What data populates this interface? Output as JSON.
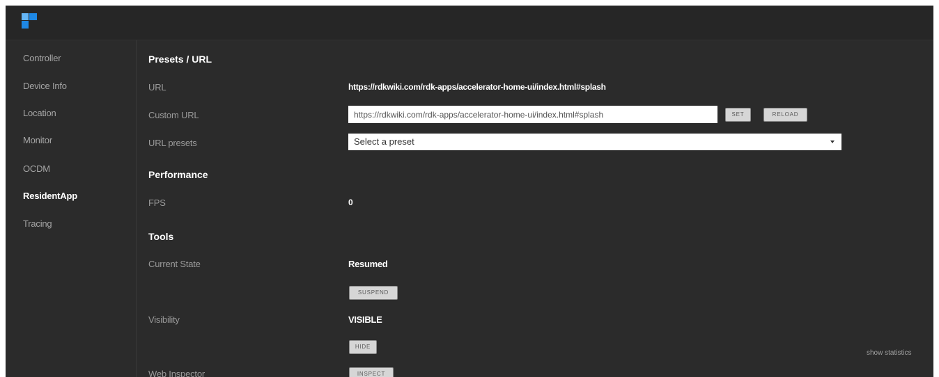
{
  "colors": {
    "background": "#2b2b2b",
    "topbar": "#262626",
    "logo_blue": "#1e88e5",
    "logo_light": "#64b5f6",
    "text_primary": "#ffffff",
    "text_muted": "#9a9a9a",
    "button_bg": "#d6d6d6"
  },
  "logo": {
    "icon": "logo-icon"
  },
  "sidebar": {
    "items": [
      {
        "label": "Controller",
        "active": false
      },
      {
        "label": "Device Info",
        "active": false
      },
      {
        "label": "Location",
        "active": false
      },
      {
        "label": "Monitor",
        "active": false
      },
      {
        "label": "OCDM",
        "active": false
      },
      {
        "label": "ResidentApp",
        "active": true
      },
      {
        "label": "Tracing",
        "active": false
      }
    ]
  },
  "presets": {
    "title": "Presets / URL",
    "url_label": "URL",
    "url_value": "https://rdkwiki.com/rdk-apps/accelerator-home-ui/index.html#splash",
    "custom_url_label": "Custom URL",
    "custom_url_value": "https://rdkwiki.com/rdk-apps/accelerator-home-ui/index.html#splash",
    "set_button": "SET",
    "reload_button": "RELOAD",
    "url_presets_label": "URL presets",
    "preset_selected": "Select a preset"
  },
  "performance": {
    "title": "Performance",
    "fps_label": "FPS",
    "fps_value": "0"
  },
  "tools": {
    "title": "Tools",
    "current_state_label": "Current State",
    "current_state_value": "Resumed",
    "suspend_button": "SUSPEND",
    "visibility_label": "Visibility",
    "visibility_value": "VISIBLE",
    "hide_button": "HIDE",
    "web_inspector_label": "Web Inspector",
    "inspect_button": "INSPECT"
  },
  "show_statistics": "show statistics"
}
